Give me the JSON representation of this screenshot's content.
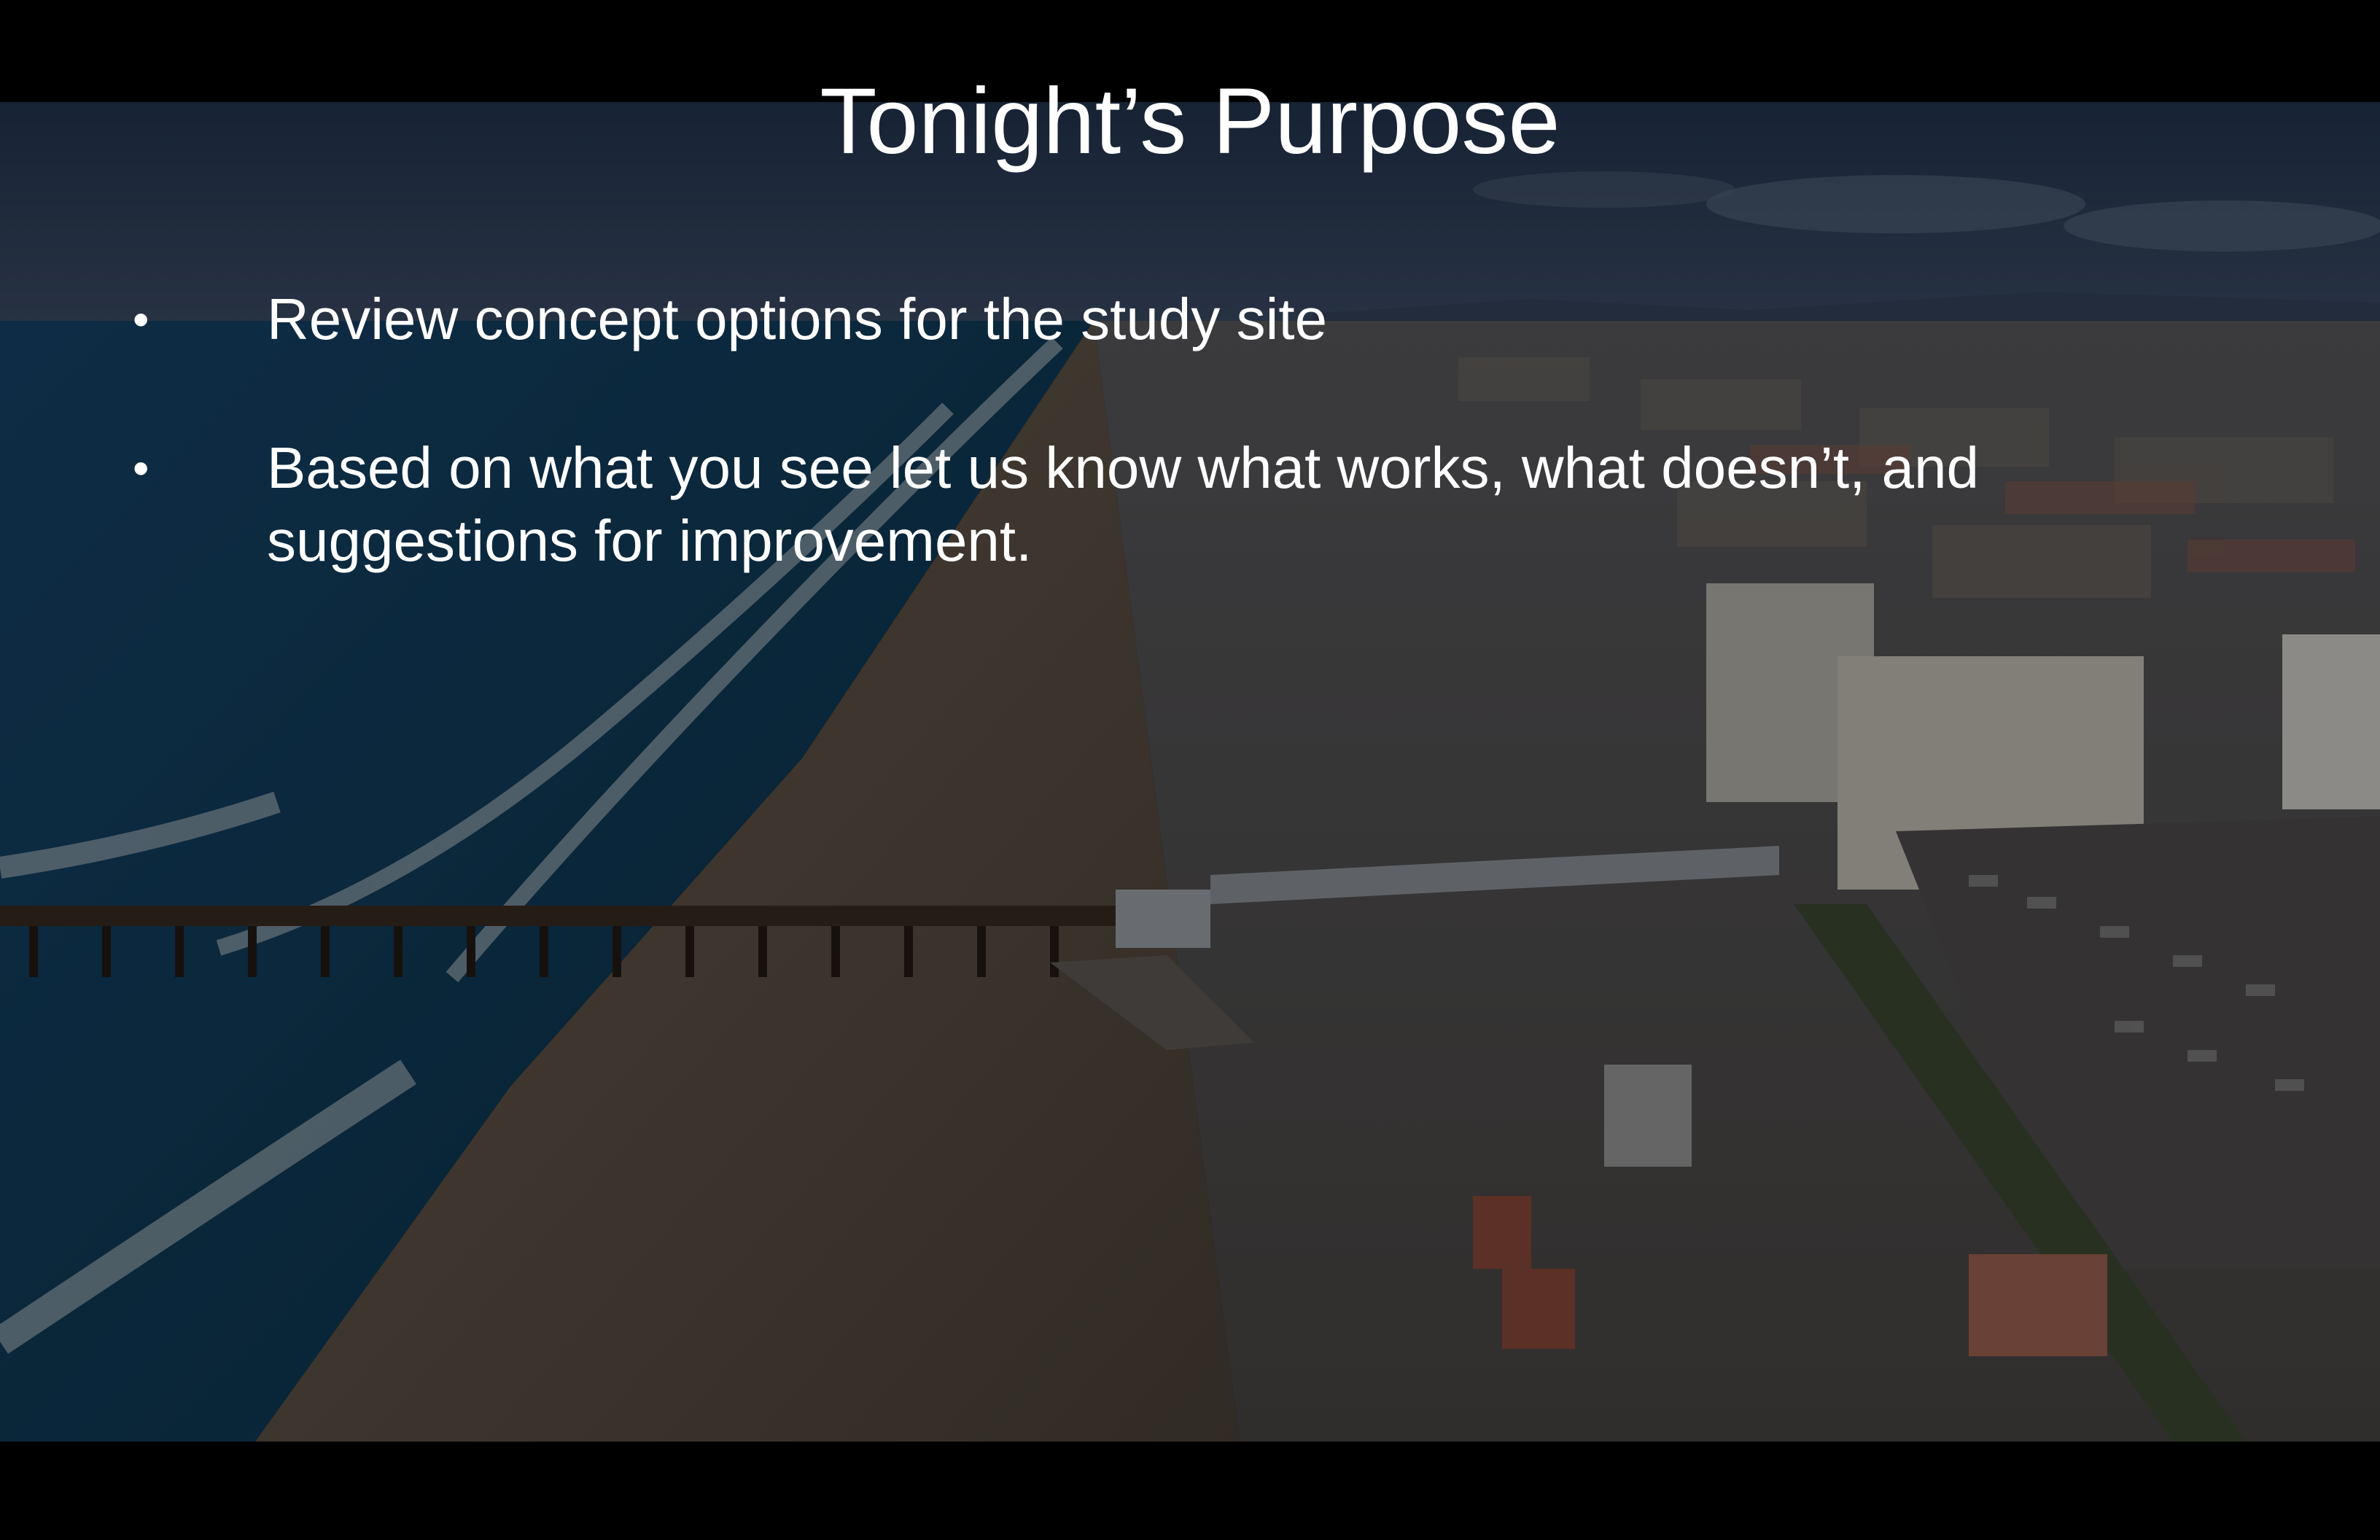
{
  "slide": {
    "title": "Tonight’s Purpose",
    "bullet_symbol": "•",
    "bullets": [
      {
        "text": "Review concept options for the study site"
      },
      {
        "text": "Based on what you see let us know what works, what doesn’t, and suggestions for improvement."
      }
    ]
  },
  "colors": {
    "background": "#000000",
    "text": "#ffffff",
    "ocean": "#0f3550",
    "sand": "#5b5046",
    "sky": "#2c3e58"
  },
  "image": {
    "subject": "aerial-beach-pier-photo"
  }
}
